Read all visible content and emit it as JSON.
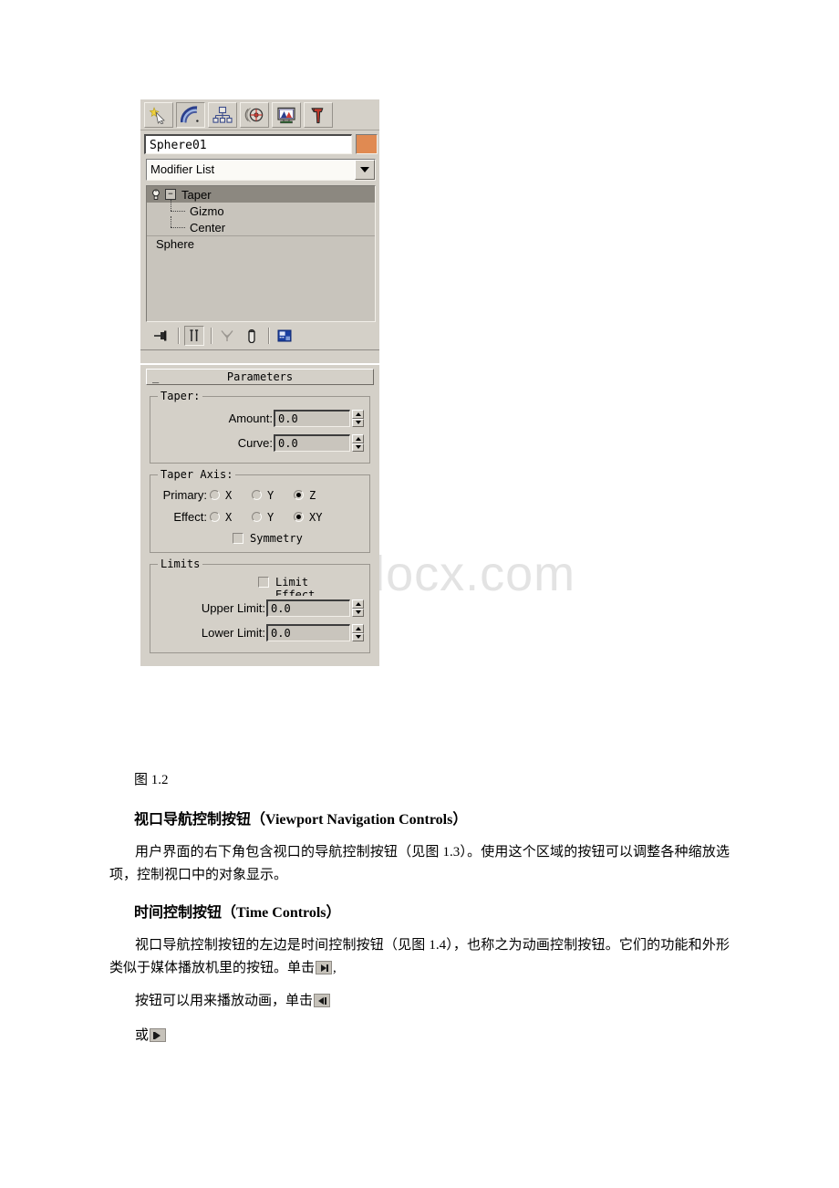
{
  "watermark": "www.bdocx.com",
  "panel": {
    "tabs": [
      {
        "name": "create-tab",
        "icon": "star-arrow-icon",
        "active": false
      },
      {
        "name": "modify-tab",
        "icon": "rainbow-arc-icon",
        "active": true
      },
      {
        "name": "hierarchy-tab",
        "icon": "hierarchy-tree-icon",
        "active": false
      },
      {
        "name": "motion-tab",
        "icon": "wheel-icon",
        "active": false
      },
      {
        "name": "display-tab",
        "icon": "monitor-icon",
        "active": false
      },
      {
        "name": "utilities-tab",
        "icon": "hammer-icon",
        "active": false
      }
    ],
    "object_name": "Sphere01",
    "object_color": "#e08a52",
    "modifier_list_label": "Modifier List",
    "stack": [
      {
        "label": "Taper",
        "level": "modifier",
        "selected": true,
        "expanded": true
      },
      {
        "label": "Gizmo",
        "level": "sub",
        "selected": false
      },
      {
        "label": "Center",
        "level": "sub",
        "selected": false
      },
      {
        "label": "Sphere",
        "level": "base",
        "selected": false
      }
    ],
    "stack_tools": [
      {
        "name": "pin-stack-button",
        "icon": "pin-icon",
        "pressed": false
      },
      {
        "name": "show-end-result-button",
        "icon": "show-end-result-icon",
        "pressed": true
      },
      {
        "name": "make-unique-button",
        "icon": "make-unique-icon",
        "pressed": false
      },
      {
        "name": "remove-modifier-button",
        "icon": "trash-icon",
        "pressed": false
      },
      {
        "name": "configure-sets-button",
        "icon": "configure-sets-icon",
        "pressed": false
      }
    ]
  },
  "rollout": {
    "title": "Parameters",
    "collapse_glyph": "_",
    "taper_group": {
      "title": "Taper:",
      "fields": [
        {
          "label": "Amount:",
          "value": "0.0"
        },
        {
          "label": "Curve:",
          "value": "0.0"
        }
      ]
    },
    "taper_axis_group": {
      "title": "Taper Axis:",
      "primary_label": "Primary:",
      "primary_options": [
        {
          "label": "X",
          "selected": false
        },
        {
          "label": "Y",
          "selected": false
        },
        {
          "label": "Z",
          "selected": true
        }
      ],
      "effect_label": "Effect:",
      "effect_options": [
        {
          "label": "X",
          "selected": false
        },
        {
          "label": "Y",
          "selected": false
        },
        {
          "label": "XY",
          "selected": true
        }
      ],
      "symmetry_label": "Symmetry",
      "symmetry_checked": false
    },
    "limits_group": {
      "title": "Limits",
      "limit_effect_label": "Limit",
      "limit_effect_label_line2": "Effect",
      "limit_effect_checked": false,
      "fields": [
        {
          "label": "Upper Limit:",
          "value": "0.0"
        },
        {
          "label": "Lower Limit:",
          "value": "0.0"
        }
      ]
    }
  },
  "document": {
    "figure_caption": "图 1.2",
    "heading_1": "视口导航控制按钮（Viewport Navigation Controls）",
    "paragraph_1": "用户界面的右下角包含视口的导航控制按钮（见图 1.3）。使用这个区域的按钮可以调整各种缩放选项，控制视口中的对象显示。",
    "heading_2": "时间控制按钮（Time Controls）",
    "paragraph_2_a": "视口导航控制按钮的左边是时间控制按钮（见图 1.4），也称之为动画控制按钮。它们的功能和外形类似于媒体播放机里的按钮。单击",
    "paragraph_2_b": ",",
    "paragraph_3_a": "按钮可以用来播放动画，单击",
    "paragraph_4_a": "或",
    "icons": {
      "play_button": "play-icon",
      "prev_frame_button": "previous-frame-icon",
      "next_frame_button": "next-frame-icon"
    }
  }
}
